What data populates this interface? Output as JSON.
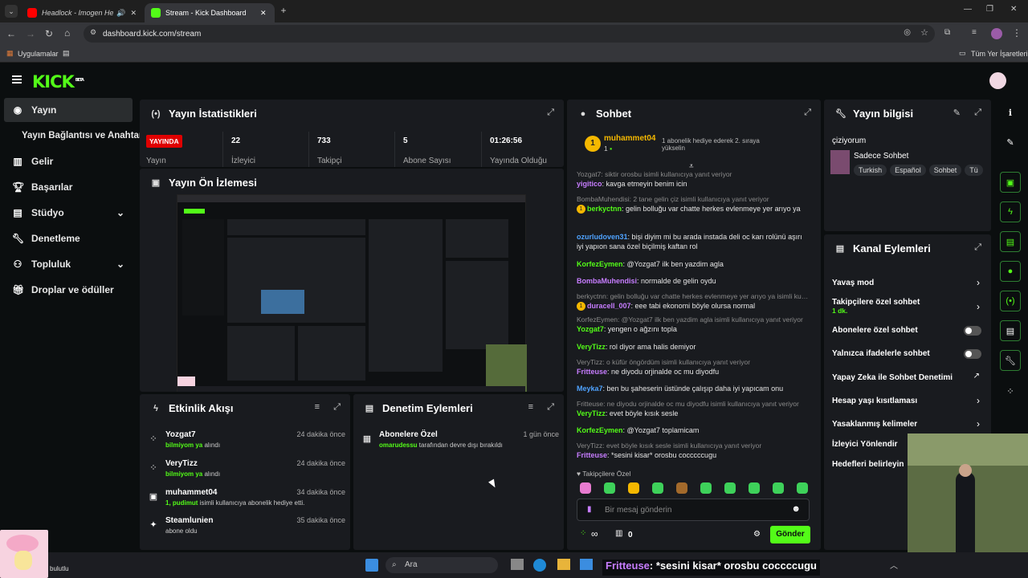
{
  "browser": {
    "tabs": [
      {
        "title": "Headlock - Imogen Heap",
        "icon": "youtube-icon"
      },
      {
        "title": "Stream - Kick Dashboard",
        "icon": "kick-icon"
      }
    ],
    "url": "dashboard.kick.com/stream",
    "bookmarks": {
      "apps": "Uygulamalar",
      "all_bookmarks": "Tüm Yer İşaretleri"
    }
  },
  "header": {
    "logo": "KICK",
    "logo_badge": "BETA"
  },
  "sidebar": {
    "items": [
      {
        "label": "Yayın",
        "icon": "broadcast-icon"
      },
      {
        "label": "Yayın Bağlantısı ve Anahtarı",
        "icon": ""
      },
      {
        "label": "Gelir",
        "icon": "chart-icon"
      },
      {
        "label": "Başarılar",
        "icon": "trophy-icon"
      },
      {
        "label": "Stüdyo",
        "icon": "studio-icon"
      },
      {
        "label": "Denetleme",
        "icon": "wrench-icon"
      },
      {
        "label": "Topluluk",
        "icon": "community-icon"
      },
      {
        "label": "Droplar ve ödüller",
        "icon": "gift-icon"
      }
    ]
  },
  "stats": {
    "title": "Yayın İstatistikleri",
    "live_badge": "YAYINDA",
    "live_label": "Yayın",
    "items": [
      {
        "value": "22",
        "label": "İzleyici"
      },
      {
        "value": "733",
        "label": "Takipçi"
      },
      {
        "value": "5",
        "label": "Abone Sayısı"
      },
      {
        "value": "01:26:56",
        "label": "Yayında Olduğu"
      }
    ]
  },
  "preview": {
    "title": "Yayın Ön İzlemesi"
  },
  "activity": {
    "title": "Etkinlik Akışı",
    "items": [
      {
        "name": "Yozgat7",
        "highlight": "bilmiyom ya",
        "detail": " alındı",
        "time": "24 dakika önce"
      },
      {
        "name": "VeryTizz",
        "highlight": "bilmiyom ya",
        "detail": " alındı",
        "time": "24 dakika önce"
      },
      {
        "name": "muhammet04",
        "highlight": "1, pudimut",
        "detail": " isimli kullanıcıya abonelik hediye etti.",
        "time": "34 dakika önce"
      },
      {
        "name": "Steamlunien",
        "highlight": "",
        "detail": "abone oldu",
        "time": "35 dakika önce"
      }
    ]
  },
  "moderation": {
    "title": "Denetim Eylemleri",
    "items": [
      {
        "name": "Abonelere Özel",
        "user": "omarudessu",
        "detail": " tarafından devre dışı bırakıldı",
        "time": "1 gün önce"
      }
    ]
  },
  "chat": {
    "title": "Sohbet",
    "pinned": {
      "user": "muhammet04",
      "count": "1",
      "text": "1 abonelik hediye ederek 2. sıraya yükselin"
    },
    "messages": [
      {
        "reply": "Yozgat7: siktir orosbu isimli kullanıcıya yanıt veriyor",
        "user": "yigitico",
        "color": "#c77dff",
        "text": ": kavga etmeyin benim icin"
      },
      {
        "reply": "BombaMuhendisi: 2 tane gelin çiz isimli kullanıcıya yanıt veriyor",
        "user": "berkyctnn",
        "color": "#53fc18",
        "text": ": gelin bolluğu var chatte herkes evlenmeye yer arıyo ya"
      },
      {
        "reply": "",
        "user": "ozurludoven31",
        "color": "#4fa3ff",
        "text": ": bişi diyim mi bu arada instada deli oc karı rolünü aşırı iyi yapıon sana özel biçilmiş kaftan rol"
      },
      {
        "reply": "",
        "user": "KorfezEymen",
        "color": "#53fc18",
        "text": ": @Yozgat7 ilk ben yazdim agla"
      },
      {
        "reply": "",
        "user": "BombaMuhendisi",
        "color": "#c77dff",
        "text": ": normalde de gelin oydu"
      },
      {
        "reply": "berkyctnn: gelin bolluğu var chatte herkes evlenmeye yer arıyo ya isimli kullanıcıya yanıt veriyor",
        "user": "duracell_007",
        "color": "#c77dff",
        "text": ": eee tabi ekonomi böyle olursa normal"
      },
      {
        "reply": "KorfezEymen: @Yozgat7 ilk ben yazdim agla isimli kullanıcıya yanıt veriyor",
        "user": "Yozgat7",
        "color": "#53fc18",
        "text": ": yengen o ağzını topla"
      },
      {
        "reply": "",
        "user": "VeryTizz",
        "color": "#53fc18",
        "text": ": rol diyor ama halis demiyor"
      },
      {
        "reply": "VeryTizz: o küfür öngördüm isimli kullanıcıya yanıt veriyor",
        "user": "Fritteuse",
        "color": "#c77dff",
        "text": ": ne diyodu orjinalde oc mu diyodfu"
      },
      {
        "reply": "",
        "user": "Meyka7",
        "color": "#4fa3ff",
        "text": ": ben bu şaheserin üstünde çalışıp daha iyi yapıcam onu"
      },
      {
        "reply": "Fritteuse: ne diyodu orjinalde oc mu diyodfu isimli kullanıcıya yanıt veriyor",
        "user": "VeryTizz",
        "color": "#53fc18",
        "text": ": evet böyle kısık sesle"
      },
      {
        "reply": "",
        "user": "KorfezEymen",
        "color": "#53fc18",
        "text": ": @Yozgat7 toplamicam"
      },
      {
        "reply": "VeryTizz: evet böyle kısık sesle isimli kullanıcıya yanıt veriyor",
        "user": "Fritteuse",
        "color": "#c77dff",
        "text": ": *sesini kisar* orosbu cocccccugu"
      }
    ],
    "followers_label": "Takipçilere Özel",
    "input_placeholder": "Bir mesaj gönderin",
    "points": "0",
    "send_label": "Gönder"
  },
  "stream_info": {
    "title": "Yayın bilgisi",
    "stream_title": "çiziyorum",
    "category": "Sadece Sohbet",
    "tags": [
      "Turkish",
      "Español",
      "Sohbet",
      "Tü"
    ]
  },
  "channel_actions": {
    "title": "Kanal Eylemleri",
    "items": [
      {
        "label": "Yavaş mod",
        "sub": "",
        "control": "chevron"
      },
      {
        "label": "Takipçilere özel sohbet",
        "sub": "1 dk.",
        "control": "chevron"
      },
      {
        "label": "Abonelere özel sohbet",
        "sub": "",
        "control": "toggle"
      },
      {
        "label": "Yalnızca ifadelerle sohbet",
        "sub": "",
        "control": "toggle"
      },
      {
        "label": "Yapay Zeka ile Sohbet Denetimi",
        "sub": "",
        "control": "external"
      },
      {
        "label": "Hesap yaşı kısıtlaması",
        "sub": "",
        "control": "chevron"
      },
      {
        "label": "Yasaklanmış kelimeler",
        "sub": "",
        "control": "chevron"
      },
      {
        "label": "İzleyici Yönlendir",
        "sub": "",
        "control": ""
      },
      {
        "label": "Hedefleri belirleyin",
        "sub": "",
        "control": ""
      }
    ]
  },
  "taskbar": {
    "weather": "bulutlu",
    "search": "Ara",
    "overlay_user": "Fritteuse",
    "overlay_text": ": *sesini kisar* orosbu coccccugu"
  },
  "colors": {
    "accent": "#53fc18",
    "live": "#e00000",
    "panel": "#191b1f",
    "bg": "#0b0e0f"
  }
}
